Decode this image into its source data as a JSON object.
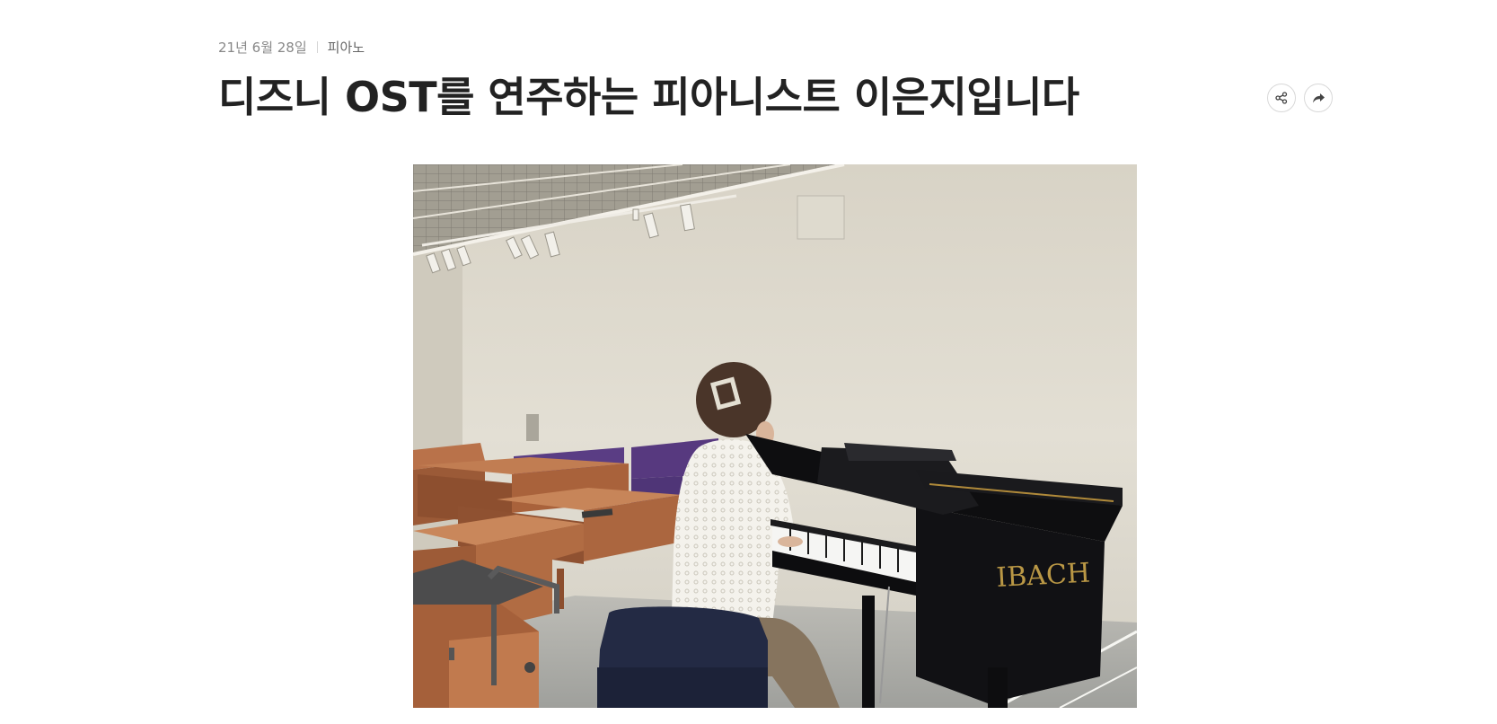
{
  "post": {
    "date": "21년 6월 28일",
    "category": "피아노",
    "title": "디즈니 OST를 연주하는 피아니스트 이은지입니다"
  },
  "actions": {
    "share_icon": "share-icon",
    "forward_icon": "forward-arrow-icon"
  },
  "photo": {
    "brand_text": "IBACH",
    "description_icon": "photo-image"
  }
}
